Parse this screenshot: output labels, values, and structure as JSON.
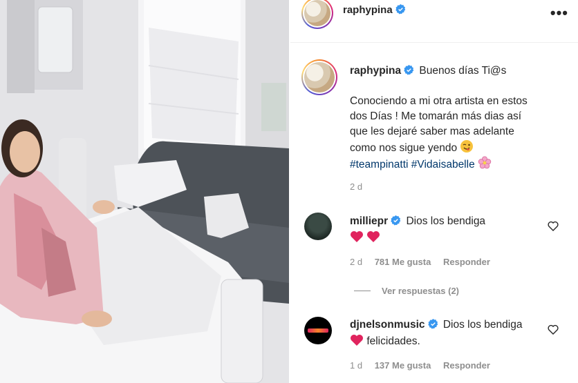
{
  "post": {
    "author": "raphypina",
    "caption": {
      "greeting": "Buenos días Ti@s",
      "lines": [
        "Conociendo a mi otra artista en estos",
        "dos Días ! Me tomarán más dias así",
        "que les dejaré saber mas adelante",
        "como nos sigue yendo"
      ],
      "hashtags": [
        "#teampinatti",
        "#Vidaisabelle"
      ],
      "time": "2 d"
    }
  },
  "comments": [
    {
      "author": "milliepr",
      "text": "Dios los bendiga",
      "time": "2 d",
      "likes": "781 Me gusta",
      "reply_label": "Responder",
      "view_replies": "Ver respuestas (2)"
    },
    {
      "author": "djnelsonmusic",
      "text": "Dios los bendiga",
      "text2": "felicidades.",
      "time": "1 d",
      "likes": "137 Me gusta",
      "reply_label": "Responder"
    }
  ],
  "icons": {
    "verified": "verified-badge-icon",
    "more": "more-options-icon",
    "like": "heart-outline-icon"
  },
  "colors": {
    "verified": "#3897f0",
    "hashtag": "#00376b",
    "meta": "#8e8e8e",
    "red_heart": "#e0245e"
  },
  "more_glyph": "•••"
}
